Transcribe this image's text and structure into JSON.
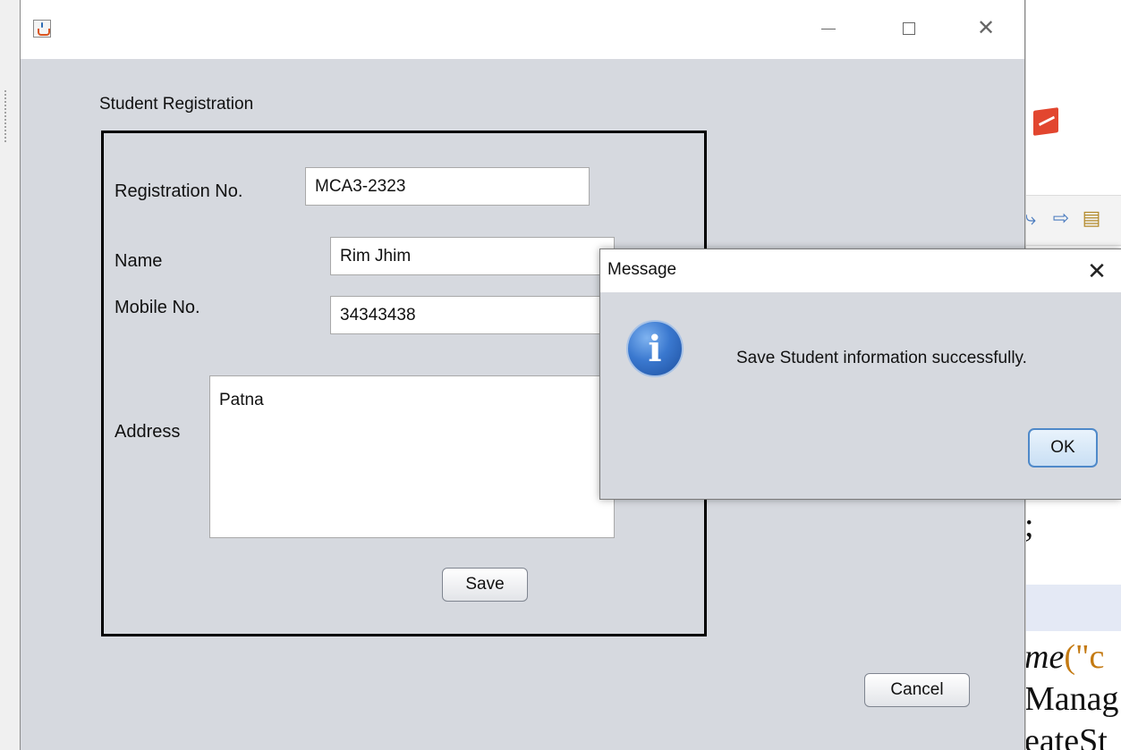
{
  "main_window": {
    "title": "",
    "caption": "Student Registration",
    "fields": {
      "registration_label": "Registration No.",
      "registration_value": "MCA3-2323",
      "name_label": "Name",
      "name_value": "Rim Jhim",
      "mobile_label": "Mobile No.",
      "mobile_value": "34343438",
      "address_label": "Address",
      "address_value": "Patna"
    },
    "save_label": "Save",
    "cancel_label": "Cancel",
    "controls": {
      "minimize_glyph": "—",
      "close_glyph": "✕"
    }
  },
  "dialog": {
    "title": "Message",
    "message": "Save Student information successfully.",
    "ok_label": "OK",
    "close_glyph": "✕",
    "icon": "info-icon",
    "icon_glyph": "i"
  },
  "background_editor": {
    "code_lines": [
      "me(\"c",
      "Manag",
      "eateSt"
    ],
    "semicolon": ";",
    "toolbar_icons": [
      "step-icon",
      "arrow-icon",
      "document-icon"
    ]
  },
  "colors": {
    "window_bg": "#d6d9df",
    "accent": "#4f89c9",
    "info_blue": "#3a78cf",
    "code_string": "#c47a12"
  }
}
